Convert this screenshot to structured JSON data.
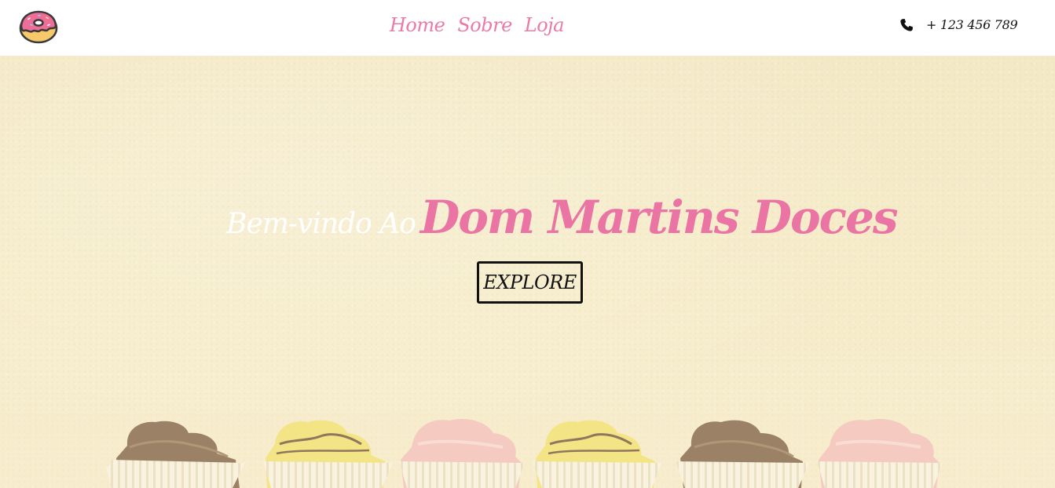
{
  "header": {
    "logo_icon": "donut-icon",
    "nav": [
      {
        "label": "Home"
      },
      {
        "label": "Sobre"
      },
      {
        "label": "Loja"
      }
    ],
    "phone_icon": "phone-icon",
    "phone_number": "+ 123 456 789"
  },
  "hero": {
    "title_lead": "Bem-vindo Ao",
    "title_brand": "Dom Martins Doces",
    "button_label": "EXPLORE"
  },
  "colors": {
    "accent_pink": "#ea74a3",
    "hero_background": "#f5ecc8",
    "header_background": "#ffffff",
    "text_dark": "#111111"
  }
}
